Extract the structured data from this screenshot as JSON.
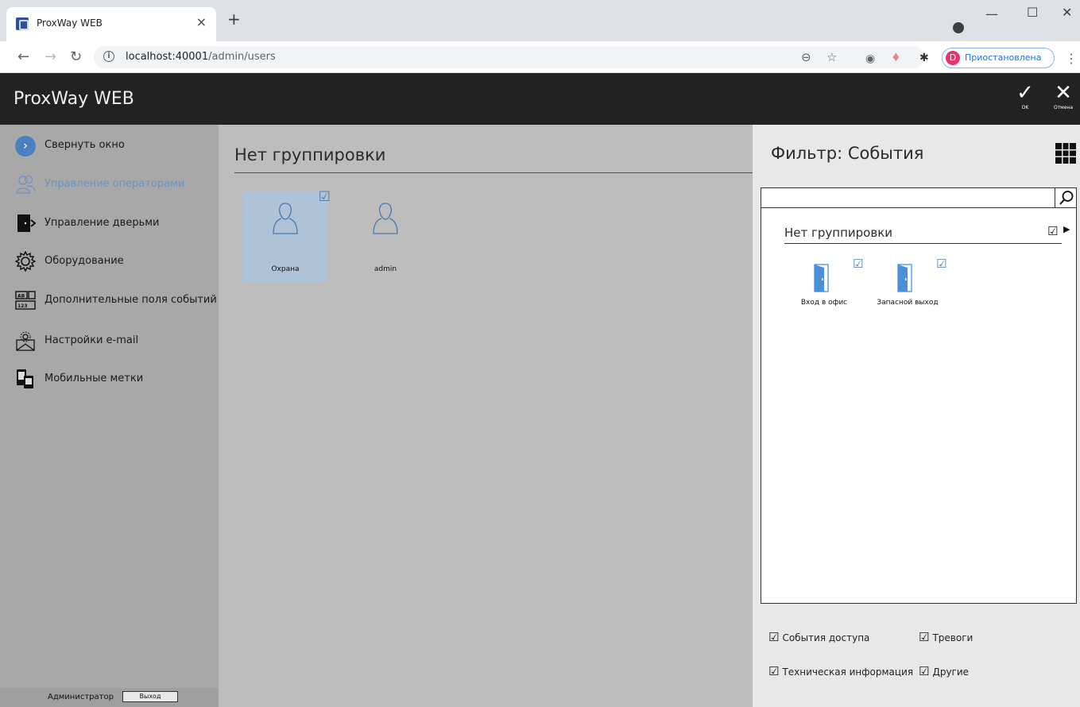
{
  "browser": {
    "tab_title": "ProxWay WEB",
    "tab_close": "×",
    "new_tab": "+",
    "url_host": "localhost:40001",
    "url_path": "/admin/users",
    "profile_initial": "D",
    "profile_label": "Приостановлена",
    "profile_color": "#e8336d"
  },
  "app": {
    "title": "ProxWay WEB",
    "ok_label": "OK",
    "cancel_label": "Отмена"
  },
  "sidebar": {
    "items": [
      {
        "label": "Свернуть окно",
        "icon": "chevron-right-circle-icon"
      },
      {
        "label": "Управление операторами",
        "icon": "operators-icon",
        "active": true
      },
      {
        "label": "Управление дверьми",
        "icon": "door-icon"
      },
      {
        "label": "Оборудование",
        "icon": "gear-icon"
      },
      {
        "label": "Дополнительные поля событий",
        "icon": "fields-icon"
      },
      {
        "label": "Настройки e-mail",
        "icon": "email-settings-icon"
      },
      {
        "label": "Мобильные метки",
        "icon": "mobile-tags-icon"
      }
    ],
    "footer_user": "Администратор",
    "footer_logout": "Выход"
  },
  "main": {
    "group_title": "Нет группировки",
    "users": [
      {
        "name": "Охрана",
        "selected": true,
        "checked": true
      },
      {
        "name": "admin",
        "selected": false,
        "checked": false
      }
    ]
  },
  "filter": {
    "title": "Фильтр: События",
    "search_value": "",
    "group_title": "Нет группировки",
    "doors": [
      {
        "name": "Вход в офис",
        "checked": true
      },
      {
        "name": "Запасной выход",
        "checked": true
      }
    ],
    "options": {
      "access_events": "События доступа",
      "alarms": "Тревоги",
      "tech_info": "Техническая информация",
      "other": "Другие"
    }
  },
  "colors": {
    "header_bg": "#222222",
    "sidebar_bg": "#a8a8a8",
    "main_bg": "#bdbdbd",
    "accent": "#4a7fc0",
    "selected_tile": "#aec3d8"
  }
}
